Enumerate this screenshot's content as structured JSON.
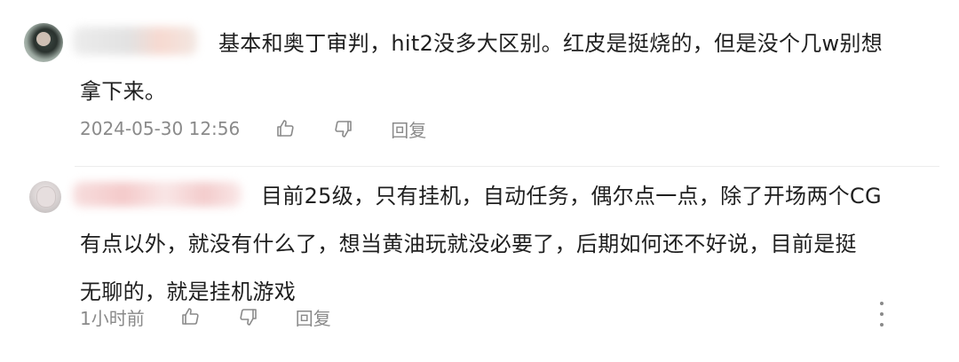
{
  "comments": [
    {
      "text_line1": "基本和奥丁审判，hit2没多大区别。红皮是挺烧的，但是没个几w别想",
      "text_line2": "拿下来。",
      "timestamp": "2024-05-30 12:56",
      "reply_label": "回复",
      "like_icon": "thumbs-up-icon",
      "dislike_icon": "thumbs-down-icon"
    },
    {
      "text_line1": "目前25级，只有挂机，自动任务，偶尔点一点，除了开场两个CG",
      "text_line2": "有点以外，就没有什么了，想当黄油玩就没必要了，后期如何还不好说，目前是挺",
      "text_line3": "无聊的，就是挂机游戏",
      "timestamp": "1小时前",
      "reply_label": "回复",
      "like_icon": "thumbs-up-icon",
      "dislike_icon": "thumbs-down-icon",
      "more_icon": "more-vertical-icon"
    }
  ]
}
